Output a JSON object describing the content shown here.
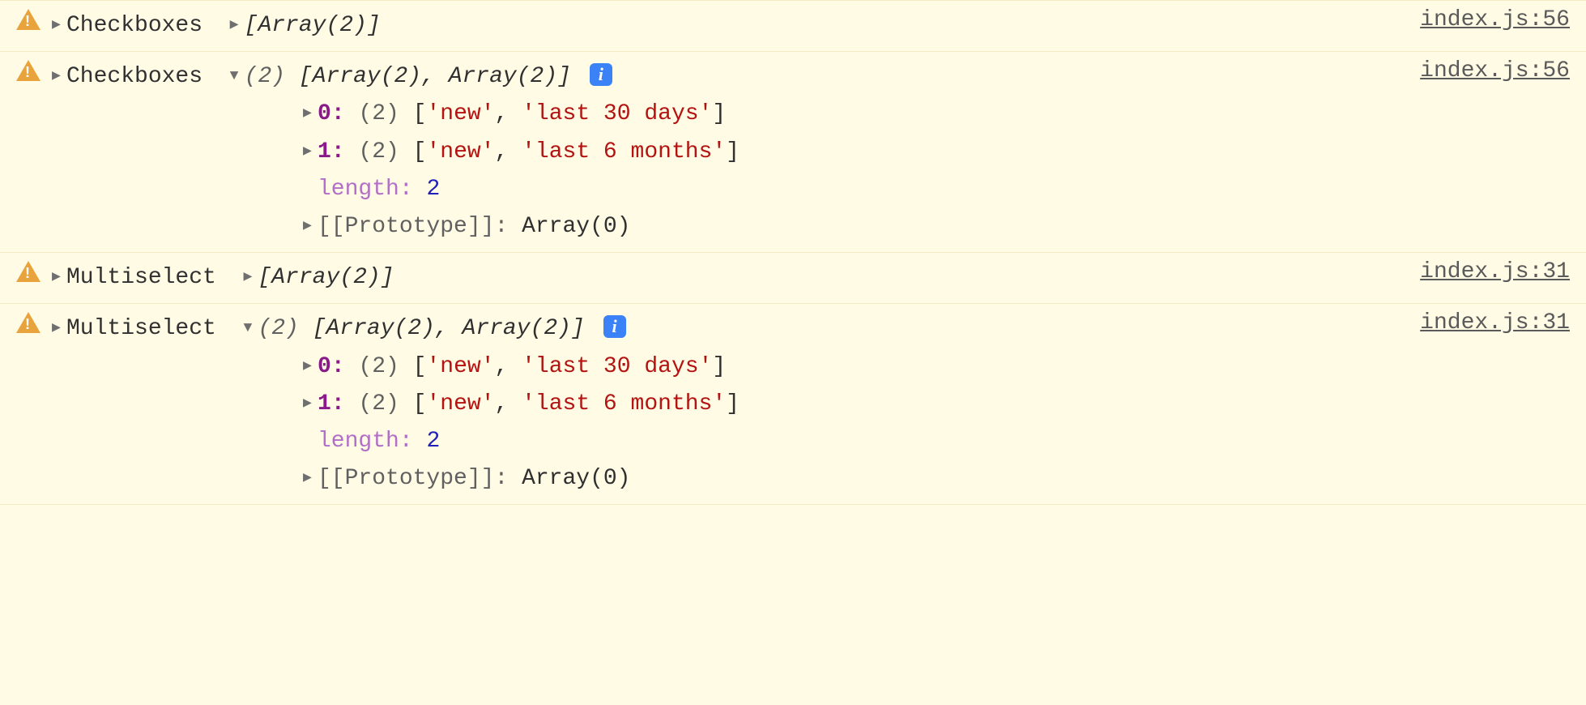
{
  "rows": [
    {
      "label": "Checkboxes",
      "expanded": false,
      "summary": "[Array(2)]",
      "source": "index.js:56"
    },
    {
      "label": "Checkboxes",
      "expanded": true,
      "summary_count": "(2)",
      "summary": "[Array(2), Array(2)]",
      "info": "i",
      "items": [
        {
          "index": "0",
          "count": "(2)",
          "values": [
            "'new'",
            "'last 30 days'"
          ]
        },
        {
          "index": "1",
          "count": "(2)",
          "values": [
            "'new'",
            "'last 6 months'"
          ]
        }
      ],
      "length_label": "length",
      "length_value": "2",
      "proto_label": "[[Prototype]]",
      "proto_value": "Array(0)",
      "source": "index.js:56"
    },
    {
      "label": "Multiselect",
      "expanded": false,
      "summary": "[Array(2)]",
      "source": "index.js:31"
    },
    {
      "label": "Multiselect",
      "expanded": true,
      "summary_count": "(2)",
      "summary": "[Array(2), Array(2)]",
      "info": "i",
      "items": [
        {
          "index": "0",
          "count": "(2)",
          "values": [
            "'new'",
            "'last 30 days'"
          ]
        },
        {
          "index": "1",
          "count": "(2)",
          "values": [
            "'new'",
            "'last 6 months'"
          ]
        }
      ],
      "length_label": "length",
      "length_value": "2",
      "proto_label": "[[Prototype]]",
      "proto_value": "Array(0)",
      "source": "index.js:31"
    }
  ]
}
